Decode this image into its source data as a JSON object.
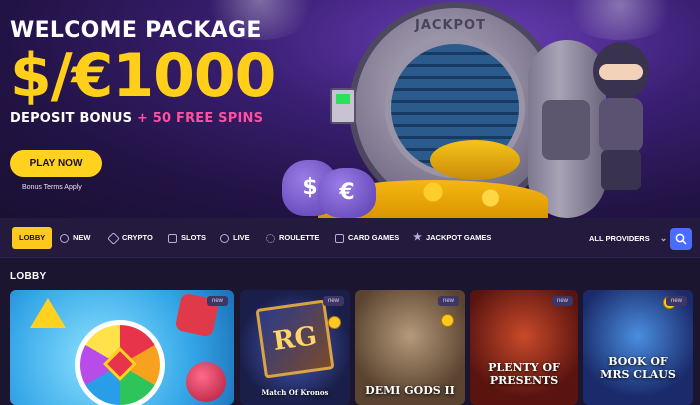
{
  "hero": {
    "welcome": "WELCOME PACKAGE",
    "amount": "$/€1000",
    "deposit_bonus": "DEPOSIT BONUS",
    "plus": "+",
    "free_spins": "50 FREE SPINS",
    "play_button": "PLAY NOW",
    "terms": "Bonus Terms Apply",
    "vault_label": "JACKPOT",
    "bag_left": "$",
    "bag_right": "€"
  },
  "nav": {
    "items": [
      {
        "label": "LOBBY",
        "icon": "none",
        "active": true
      },
      {
        "label": "NEW",
        "icon": "new-icon"
      },
      {
        "label": "CRYPTO",
        "icon": "crypto-icon"
      },
      {
        "label": "SLOTS",
        "icon": "slots-icon"
      },
      {
        "label": "LIVE",
        "icon": "live-icon"
      },
      {
        "label": "ROULETTE",
        "icon": "roulette-icon"
      },
      {
        "label": "CARD GAMES",
        "icon": "card-games-icon"
      },
      {
        "label": "JACKPOT GAMES",
        "icon": "jackpot-star-icon"
      }
    ],
    "providers": "ALL PROVIDERS"
  },
  "lobby": {
    "title": "LOBBY",
    "tiles": [
      {
        "badge": "new",
        "label": ""
      },
      {
        "badge": "new",
        "label": "Match Of Kronos"
      },
      {
        "badge": "new",
        "label": "DEMI GODS II"
      },
      {
        "badge": "new",
        "label": "PLENTY OF PRESENTS"
      },
      {
        "badge": "new",
        "label": "BOOK OF MRS CLAUS"
      }
    ]
  },
  "colors": {
    "accent_yellow": "#ffc81f",
    "accent_pink": "#ff4fa0",
    "search_blue": "#4a6cff",
    "nav_bg": "#241a3d"
  }
}
